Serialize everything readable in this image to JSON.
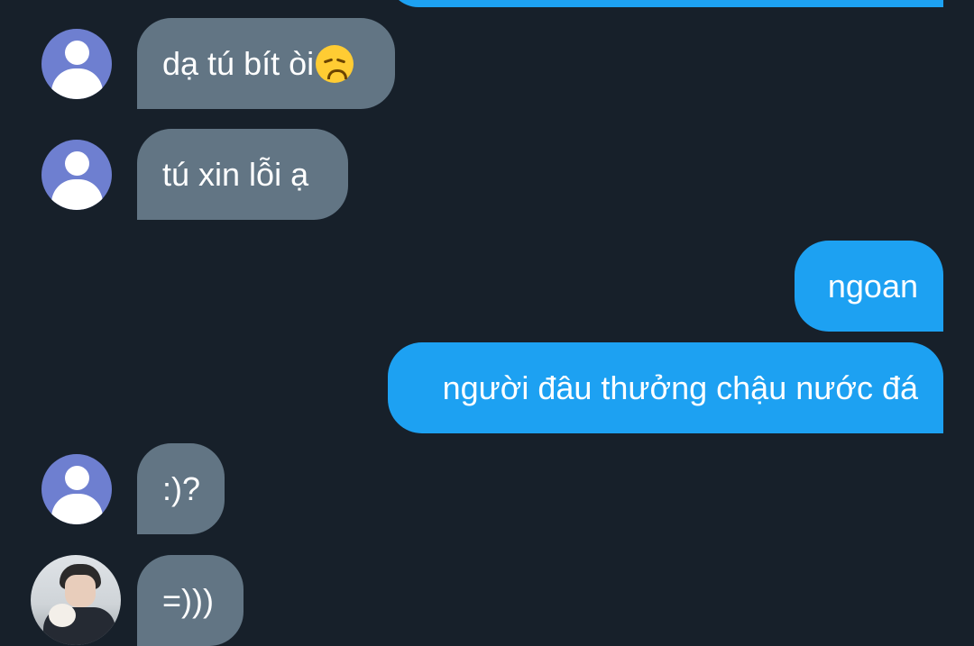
{
  "conversation": {
    "messages": [
      {
        "direction": "outgoing",
        "text": ""
      },
      {
        "direction": "incoming",
        "avatar": "default-user-avatar",
        "text": "dạ tú bít òi",
        "emoji": "disappointed-face-emoji"
      },
      {
        "direction": "incoming",
        "avatar": "default-user-avatar",
        "text": "tú xin lỗi ạ"
      },
      {
        "direction": "outgoing",
        "text": "ngoan"
      },
      {
        "direction": "outgoing",
        "text": "người đâu thưởng chậu nước đá"
      },
      {
        "direction": "incoming",
        "avatar": "default-user-avatar",
        "text": ":)?"
      },
      {
        "direction": "incoming",
        "avatar": "profile-photo-avatar",
        "text": "=)))"
      }
    ]
  },
  "colors": {
    "background": "#17202a",
    "incoming_bubble": "#627584",
    "outgoing_bubble": "#1da1f2",
    "default_avatar": "#6e7fd0"
  }
}
